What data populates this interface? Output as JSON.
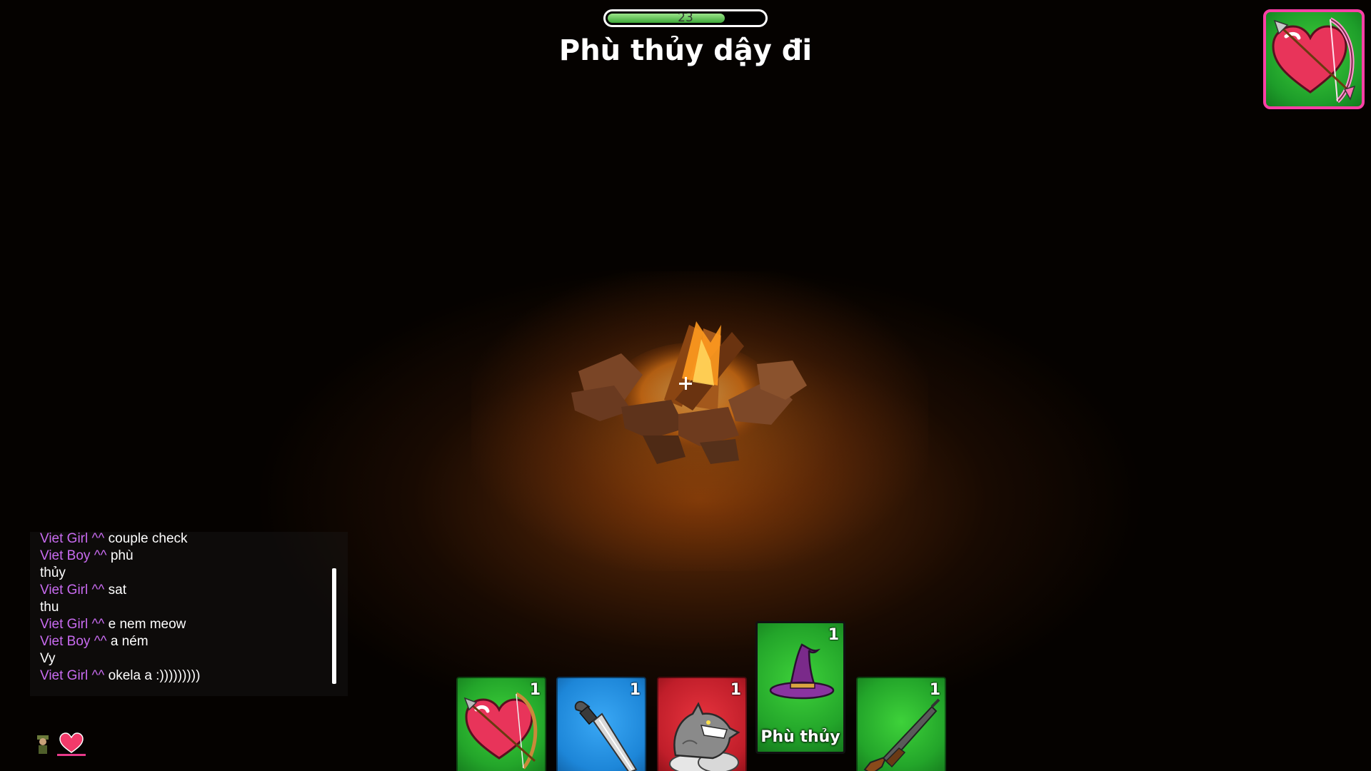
{
  "hud": {
    "timer_value": "23",
    "timer_fraction": 0.75,
    "phase_title": "Phù thủy dậy đi",
    "role_icon": "cupid-heart-bow-icon"
  },
  "chat": {
    "lines": [
      {
        "name": "Viet Girl ^^",
        "text": "couple check"
      },
      {
        "name": "Viet Boy ^^",
        "text": "phù"
      },
      {
        "name": "",
        "text": "thủy"
      },
      {
        "name": "Viet Girl ^^",
        "text": "sat"
      },
      {
        "name": "",
        "text": "thu"
      },
      {
        "name": "Viet Girl ^^",
        "text": "e nem meow"
      },
      {
        "name": "Viet Boy ^^",
        "text": "a ném"
      },
      {
        "name": "",
        "text": "Vy"
      },
      {
        "name": "Viet Girl ^^",
        "text": "okela a :)))))))))"
      }
    ]
  },
  "bottom_left_icons": [
    "soldier-icon",
    "heart-icon"
  ],
  "cards": [
    {
      "icon": "cupid-heart-bow-icon",
      "count": "1",
      "color": "#23a52a",
      "label": ""
    },
    {
      "icon": "dagger-icon",
      "count": "1",
      "color": "#1d86d8",
      "label": ""
    },
    {
      "icon": "werewolf-icon",
      "count": "1",
      "color": "#c01e2a",
      "label": ""
    },
    {
      "icon": "witch-hat-icon",
      "count": "1",
      "color": "#23a52a",
      "label": "Phù thủy"
    },
    {
      "icon": "shotgun-icon",
      "count": "1",
      "color": "#23a52a",
      "label": ""
    }
  ]
}
